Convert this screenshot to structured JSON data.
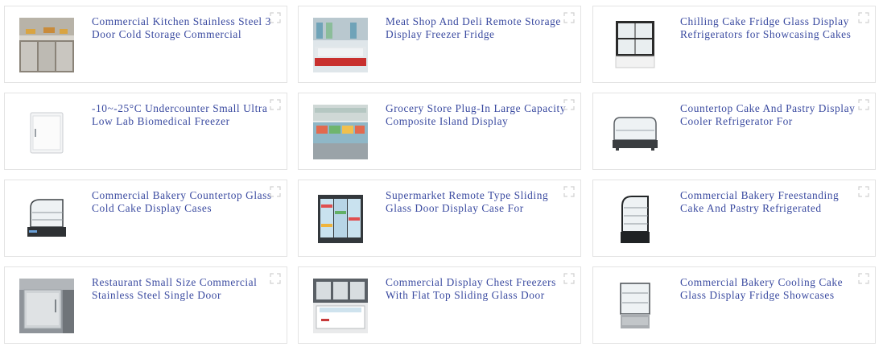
{
  "products": [
    {
      "title": "Commercial Kitchen Stainless Steel 3 Door Cold Storage Commercial",
      "image_icon": "stainless-counter-fridge-photo"
    },
    {
      "title": "Meat Shop And Deli Remote Storage Display Freezer Fridge",
      "image_icon": "deli-display-freezer-photo"
    },
    {
      "title": "Chilling Cake Fridge Glass Display Refrigerators for Showcasing Cakes",
      "image_icon": "cake-display-fridge-photo"
    },
    {
      "title": "-10~-25°C Undercounter Small Ultra Low Lab Biomedical Freezer",
      "image_icon": "undercounter-freezer-photo"
    },
    {
      "title": "Grocery Store Plug-In Large Capacity Composite Island Display",
      "image_icon": "island-display-freezer-photo"
    },
    {
      "title": "Countertop Cake And Pastry Display Cooler Refrigerator For",
      "image_icon": "countertop-cake-cooler-photo"
    },
    {
      "title": "Commercial Bakery Countertop Glass Cold Cake Display Cases",
      "image_icon": "curved-glass-cake-case-photo"
    },
    {
      "title": "Supermarket Remote Type Sliding Glass Door Display Case For",
      "image_icon": "sliding-door-display-case-photo"
    },
    {
      "title": "Commercial Bakery Freestanding Cake And Pastry Refrigerated",
      "image_icon": "freestanding-cake-refrigerator-photo"
    },
    {
      "title": "Restaurant Small Size Commercial Stainless Steel Single Door",
      "image_icon": "single-door-steel-fridge-photo"
    },
    {
      "title": "Commercial Display Chest Freezers With Flat Top Sliding Glass Door",
      "image_icon": "chest-freezer-photo"
    },
    {
      "title": "Commercial Bakery Cooling Cake Glass Display Fridge Showcases",
      "image_icon": "square-cake-showcase-photo"
    }
  ],
  "expand_icon": "expand-corners-icon"
}
